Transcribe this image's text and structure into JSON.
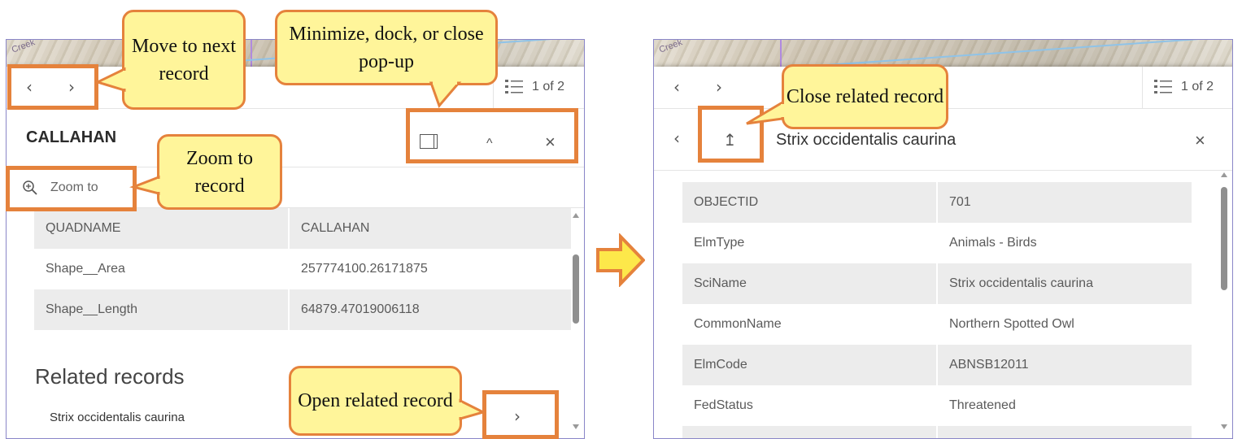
{
  "left": {
    "nav": {
      "prev": "‹",
      "next": "›"
    },
    "counter": "1 of 2",
    "title": "CALLAHAN",
    "zoom_label": "Zoom to",
    "table": [
      {
        "k": "QUADNAME",
        "v": "CALLAHAN"
      },
      {
        "k": "Shape__Area",
        "v": "257774100.26171875"
      },
      {
        "k": "Shape__Length",
        "v": "64879.47019006118"
      }
    ],
    "related_heading": "Related records",
    "related_item": "Strix occidentalis caurina",
    "related_open": "›",
    "collapse": "^",
    "close": "×"
  },
  "right": {
    "nav": {
      "prev": "‹",
      "next": "›"
    },
    "counter": "1 of 2",
    "back": "‹",
    "up": "↥",
    "title": "Strix occidentalis caurina",
    "close": "×",
    "table": [
      {
        "k": "OBJECTID",
        "v": "701"
      },
      {
        "k": "ElmType",
        "v": "Animals - Birds"
      },
      {
        "k": "SciName",
        "v": "Strix occidentalis caurina"
      },
      {
        "k": "CommonName",
        "v": "Northern Spotted Owl"
      },
      {
        "k": "ElmCode",
        "v": "ABNSB12011"
      },
      {
        "k": "FedStatus",
        "v": "Threatened"
      }
    ]
  },
  "callouts": {
    "move": "Move to next record",
    "minimize": "Minimize, dock, or close pop-up",
    "zoom": "Zoom to record",
    "open_related": "Open related record",
    "close_related": "Close related record"
  },
  "map_label": "Creek",
  "colors": {
    "accent": "#e5823c",
    "callout_fill": "#fff59a",
    "arrow_fill": "#fde84a"
  }
}
